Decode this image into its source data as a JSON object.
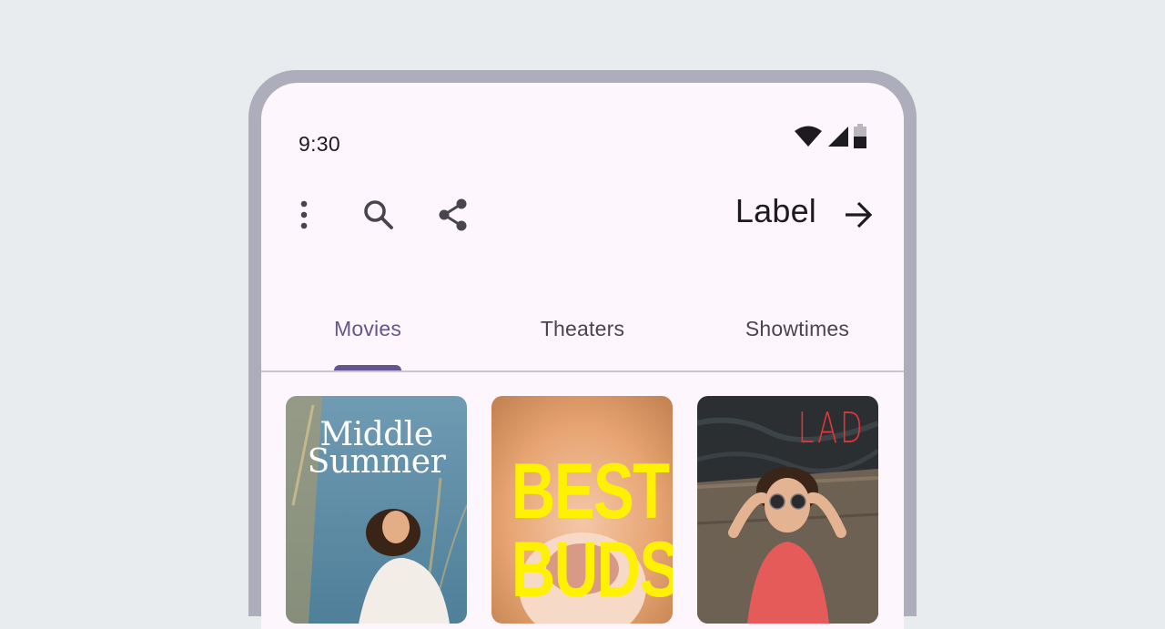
{
  "status_bar": {
    "time": "9:30",
    "icons": [
      "wifi-icon",
      "signal-icon",
      "battery-icon"
    ]
  },
  "top_bar": {
    "actions": [
      "more-vert-icon",
      "search-icon",
      "share-icon"
    ],
    "label": "Label",
    "trailing_icon": "arrow-forward-icon"
  },
  "tabs": [
    {
      "label": "Movies",
      "active": true
    },
    {
      "label": "Theaters",
      "active": false
    },
    {
      "label": "Showtimes",
      "active": false
    }
  ],
  "movies": [
    {
      "title": "Middle Summer"
    },
    {
      "title": "BEST BUDS"
    },
    {
      "title": "LAD"
    }
  ],
  "colors": {
    "background": "#e8ecef",
    "frame": "#aeadbb",
    "surface": "#fdf7fd",
    "primary": "#65558f",
    "on_surface": "#1d1b20",
    "on_surface_variant": "#49454f",
    "outline_variant": "#cac4d0"
  }
}
